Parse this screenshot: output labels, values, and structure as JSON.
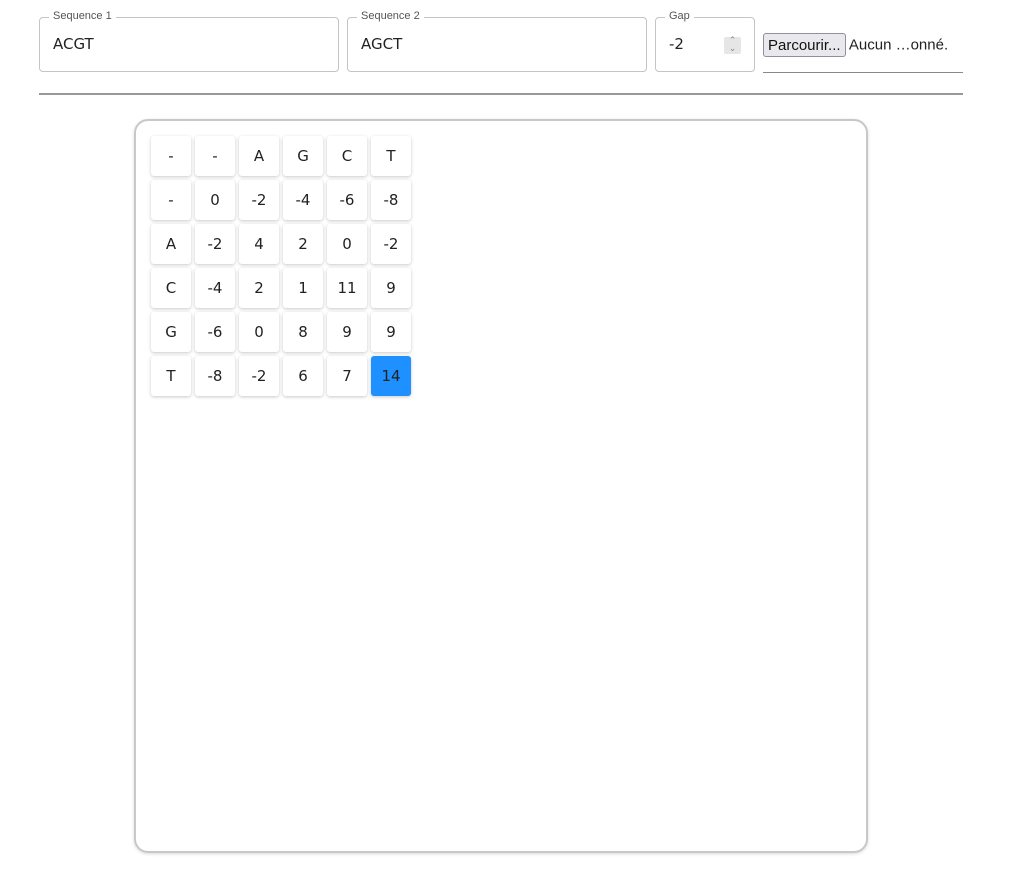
{
  "inputs": {
    "sequence1": {
      "label": "Sequence 1",
      "value": "ACGT"
    },
    "sequence2": {
      "label": "Sequence 2",
      "value": "AGCT"
    },
    "gap": {
      "label": "Gap",
      "value": "-2"
    },
    "file": {
      "button_label": "Parcourir...",
      "status": "Aucun …onné."
    }
  },
  "matrix": {
    "rows": [
      [
        "-",
        "-",
        "A",
        "G",
        "C",
        "T"
      ],
      [
        "-",
        "0",
        "-2",
        "-4",
        "-6",
        "-8"
      ],
      [
        "A",
        "-2",
        "4",
        "2",
        "0",
        "-2"
      ],
      [
        "C",
        "-4",
        "2",
        "1",
        "11",
        "9"
      ],
      [
        "G",
        "-6",
        "0",
        "8",
        "9",
        "9"
      ],
      [
        "T",
        "-8",
        "-2",
        "6",
        "7",
        "14"
      ]
    ],
    "highlighted": [
      5,
      5
    ],
    "highlight_color": "#1e90ff"
  }
}
